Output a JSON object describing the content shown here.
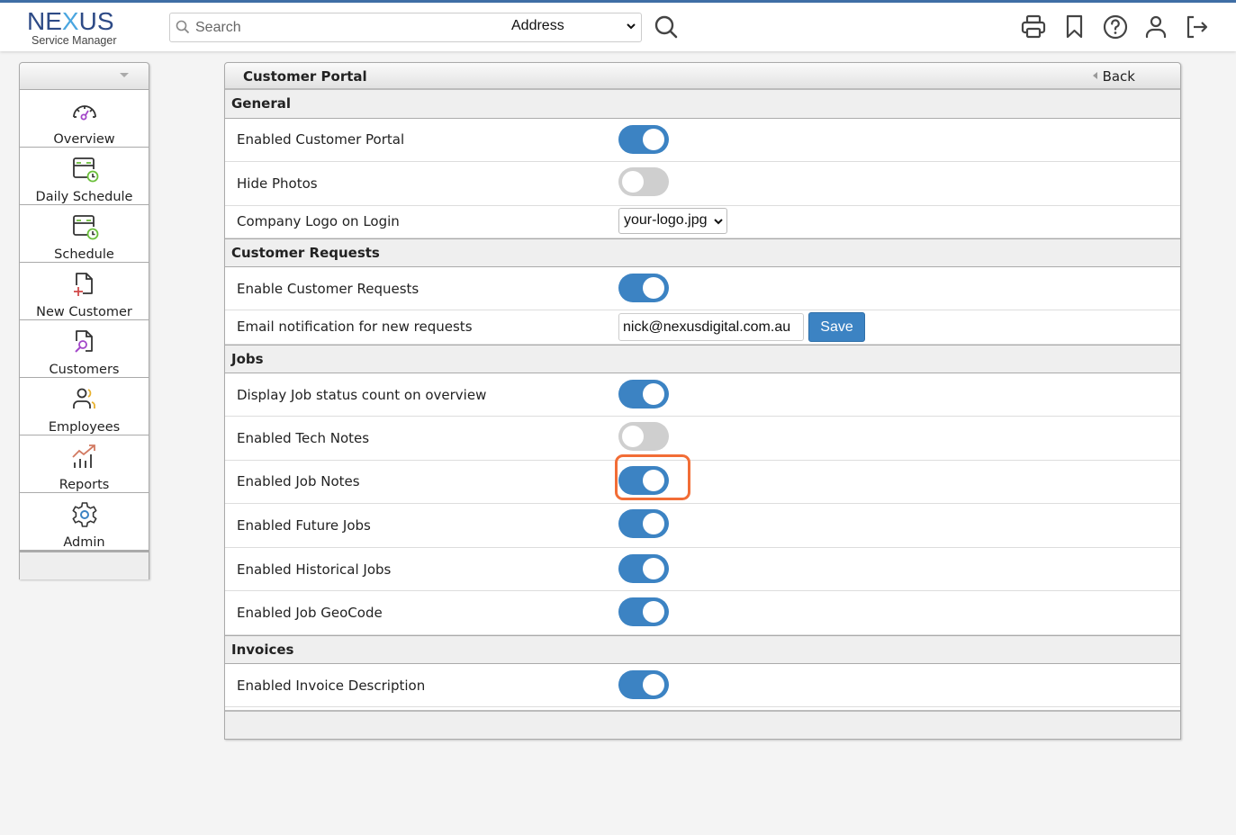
{
  "app": {
    "brand": {
      "prefix": "NE",
      "x": "X",
      "suffix": "US",
      "subtitle": "Service Manager"
    },
    "colors": {
      "accent": "#3c83c3",
      "topbar_border": "#3f6ea5",
      "highlight": "#f26d36",
      "toggle_off": "#cfcfcf"
    }
  },
  "search": {
    "placeholder": "Search",
    "value": "",
    "type_selected": "Address",
    "icon": "search-icon"
  },
  "toolbar": {
    "icons": [
      "printer-icon",
      "bookmark-icon",
      "help-icon",
      "user-icon",
      "logout-icon"
    ]
  },
  "sidebar": {
    "items": [
      {
        "label": "Overview",
        "icon": "speedometer-icon"
      },
      {
        "label": "Daily Schedule",
        "icon": "calendar-clock-icon"
      },
      {
        "label": "Schedule",
        "icon": "calendar-clock-icon"
      },
      {
        "label": "New Customer",
        "icon": "file-add-icon"
      },
      {
        "label": "Customers",
        "icon": "file-search-icon"
      },
      {
        "label": "Employees",
        "icon": "users-icon"
      },
      {
        "label": "Reports",
        "icon": "chart-growth-icon"
      },
      {
        "label": "Admin",
        "icon": "gear-icon"
      }
    ]
  },
  "panel": {
    "title": "Customer Portal",
    "back_label": "Back",
    "sections": [
      {
        "title": "General",
        "rows": [
          {
            "label": "Enabled Customer Portal",
            "type": "toggle",
            "on": true
          },
          {
            "label": "Hide Photos",
            "type": "toggle",
            "on": false
          },
          {
            "label": "Company Logo on Login",
            "type": "select",
            "value": "your-logo.jpg"
          }
        ]
      },
      {
        "title": "Customer Requests",
        "rows": [
          {
            "label": "Enable Customer Requests",
            "type": "toggle",
            "on": true
          },
          {
            "label": "Email notification for new requests",
            "type": "email",
            "value": "nick@nexusdigital.com.au",
            "button": "Save"
          }
        ]
      },
      {
        "title": "Jobs",
        "rows": [
          {
            "label": "Display Job status count on overview",
            "type": "toggle",
            "on": true
          },
          {
            "label": "Enabled Tech Notes",
            "type": "toggle",
            "on": false
          },
          {
            "label": "Enabled Job Notes",
            "type": "toggle",
            "on": true,
            "highlighted": true
          },
          {
            "label": "Enabled Future Jobs",
            "type": "toggle",
            "on": true
          },
          {
            "label": "Enabled Historical Jobs",
            "type": "toggle",
            "on": true
          },
          {
            "label": "Enabled Job GeoCode",
            "type": "toggle",
            "on": true
          }
        ]
      },
      {
        "title": "Invoices",
        "rows": [
          {
            "label": "Enabled Invoice Description",
            "type": "toggle",
            "on": true
          }
        ]
      }
    ]
  }
}
